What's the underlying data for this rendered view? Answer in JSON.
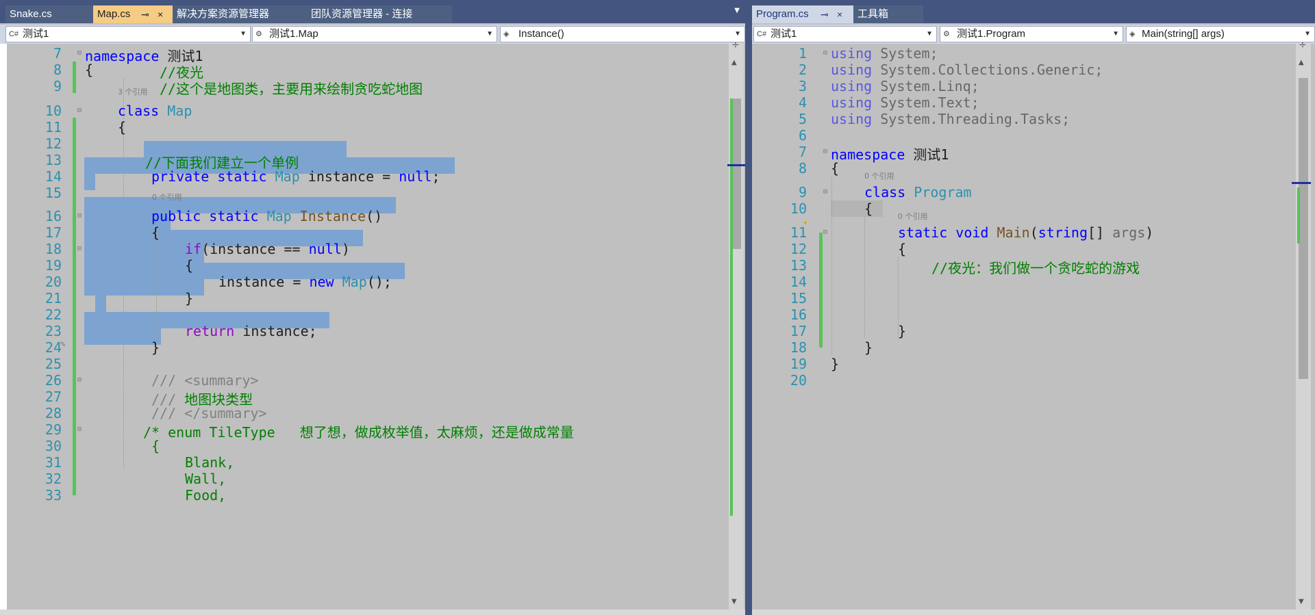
{
  "left": {
    "tabs": [
      {
        "label": "Snake.cs"
      },
      {
        "label": "Map.cs",
        "active": true,
        "pin": "⊸"
      },
      {
        "label": "解决方案资源管理器"
      },
      {
        "label": "团队资源管理器 - 连接"
      }
    ],
    "nav": {
      "project": "测试1",
      "type": "测试1.Map",
      "member": "Instance()"
    },
    "line_numbers": [
      "7",
      "8",
      "9",
      "10",
      "11",
      "12",
      "13",
      "14",
      "15",
      "16",
      "17",
      "18",
      "19",
      "20",
      "21",
      "22",
      "23",
      "24",
      "25",
      "26",
      "27",
      "28",
      "29",
      "30",
      "31",
      "32",
      "33"
    ],
    "codelens": {
      "class_refs": "3 个引用",
      "instance_refs": "0 个引用"
    },
    "code": {
      "l7_kw": "namespace",
      "l7_name": " 测试1",
      "l8_brace": "{",
      "l8_comment": "//夜光",
      "l9_comment": "//这个是地图类，主要用来绘制贪吃蛇地图",
      "l10_kw": "class",
      "l10_name": "Map",
      "l11": "{",
      "l13": "//下面我们建立一个单例",
      "l14_kw1": "private",
      "l14_kw2": "static",
      "l14_ty": "Map",
      "l14_rest": " instance = ",
      "l14_null": "null",
      "l14_end": ";",
      "l16_kw1": "public",
      "l16_kw2": "static",
      "l16_ty": "Map",
      "l16_method": "Instance",
      "l16_end": "()",
      "l17": "{",
      "l18_kw": "if",
      "l18_rest": "(instance == ",
      "l18_null": "null",
      "l18_end": ")",
      "l19": "{",
      "l20_start": "instance = ",
      "l20_new": "new",
      "l20_ty": "Map",
      "l20_end": "();",
      "l21": "}",
      "l23_kw": "return",
      "l23_rest": " instance;",
      "l24": "}",
      "l26": "/// <summary>",
      "l27_prefix": "///",
      "l27_text": " 地图块类型",
      "l28": "/// </summary>",
      "l29": "/* enum TileType   想了想，做成枚举值，太麻烦，还是做成常量",
      "l30": "{",
      "l31": "Blank,",
      "l32": "Wall,",
      "l33": "Food,"
    }
  },
  "right": {
    "tabs": [
      {
        "label": "Program.cs",
        "active": true,
        "pin": "⊸"
      },
      {
        "label": "工具箱"
      }
    ],
    "nav": {
      "project": "测试1",
      "type": "测试1.Program",
      "member": "Main(string[] args)"
    },
    "line_numbers": [
      "1",
      "2",
      "3",
      "4",
      "5",
      "6",
      "7",
      "8",
      "9",
      "10",
      "11",
      "12",
      "13",
      "14",
      "15",
      "16",
      "17",
      "18",
      "19",
      "20"
    ],
    "codelens": {
      "class_refs": "0 个引用",
      "main_refs": "0 个引用"
    },
    "code": {
      "u1": "System;",
      "u2": "System.Collections.Generic;",
      "u3": "System.Linq;",
      "u4": "System.Text;",
      "u5": "System.Threading.Tasks;",
      "using_kw": "using",
      "l7_kw": "namespace",
      "l7_name": " 测试1",
      "l8": "{",
      "l9_kw": "class",
      "l9_name": "Program",
      "l10": "{",
      "l11_kw1": "static",
      "l11_kw2": "void",
      "l11_method": "Main",
      "l11_open": "(",
      "l11_ty": "string",
      "l11_arr": "[] ",
      "l11_param": "args",
      "l11_close": ")",
      "l12": "{",
      "l13": "//夜光：我们做一个贪吃蛇的游戏",
      "l17": "}",
      "l18": "}",
      "l19": "}"
    }
  },
  "colors": {
    "keyword": "#0000ff",
    "control_keyword": "#8f08c4",
    "type": "#2b91af",
    "comment": "#008000",
    "doc_comment": "#808080",
    "selection": "#7da3d1",
    "change_bar": "#56c456",
    "active_tab": "#f5cc84"
  },
  "icons": {
    "tab_close": "×",
    "dropdown": "▼",
    "split": "÷",
    "scroll_up": "▲",
    "scroll_down": "▼",
    "lightbulb": "💡"
  }
}
